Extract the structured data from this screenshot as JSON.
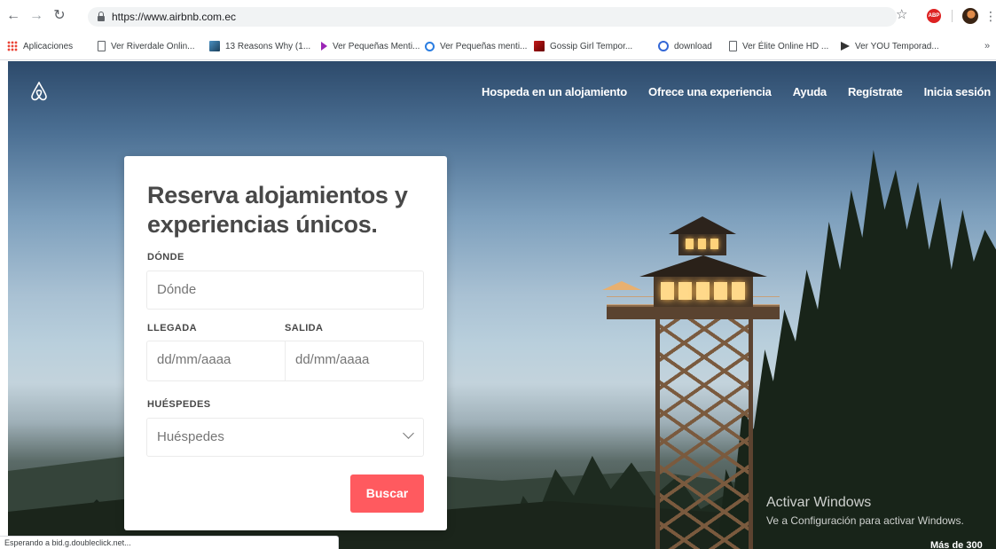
{
  "browser": {
    "url": "https://www.airbnb.com.ec",
    "bookmarks": [
      {
        "label": "Aplicaciones",
        "icon": "apps-grid-icon"
      },
      {
        "label": "Ver Riverdale Onlin...",
        "icon": "page-icon"
      },
      {
        "label": "13 Reasons Why (1...",
        "icon": "site-image-icon"
      },
      {
        "label": "Ver Pequeñas Menti...",
        "icon": "purple-play-icon"
      },
      {
        "label": "Ver Pequeñas menti...",
        "icon": "blue-circle-icon"
      },
      {
        "label": "Gossip Girl Tempor...",
        "icon": "red-site-icon"
      },
      {
        "label": "download",
        "icon": "download-site-icon"
      },
      {
        "label": "Ver Élite Online HD ...",
        "icon": "page-icon"
      },
      {
        "label": "Ver YOU Temporad...",
        "icon": "play-icon"
      }
    ],
    "more_bookmarks": "»",
    "status_text": "Esperando a bid.g.doubleclick.net..."
  },
  "header": {
    "nav": [
      "Hospeda en un alojamiento",
      "Ofrece una experiencia",
      "Ayuda",
      "Regístrate",
      "Inicia sesión"
    ]
  },
  "search_card": {
    "title": "Reserva alojamientos y experiencias únicos.",
    "where_label": "DÓNDE",
    "where_placeholder": "Dónde",
    "checkin_label": "LLEGADA",
    "checkout_label": "SALIDA",
    "checkin_placeholder": "dd/mm/aaaa",
    "checkout_placeholder": "dd/mm/aaaa",
    "guests_label": "HUÉSPEDES",
    "guests_value": "Huéspedes",
    "search_button": "Buscar"
  },
  "watermark": {
    "line1": "Activar Windows",
    "line2": "Ve a Configuración para activar Windows."
  },
  "bottom_fragment": "Más de 300",
  "colors": {
    "brand": "#ff5a5f",
    "text_dark": "#484848"
  }
}
